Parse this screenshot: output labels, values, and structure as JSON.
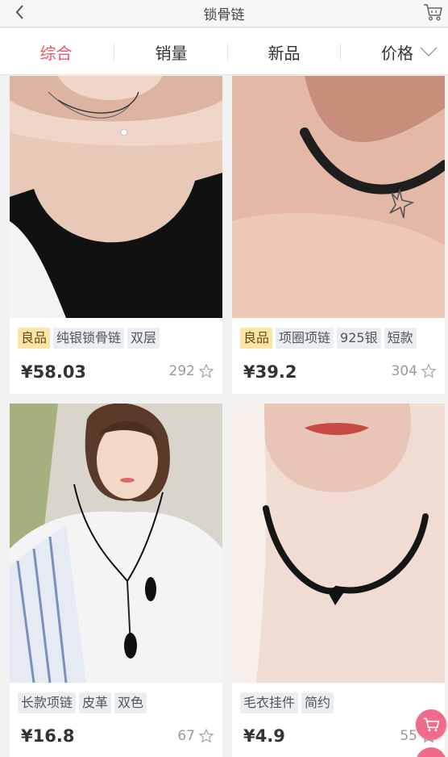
{
  "header": {
    "title": "锁骨链",
    "back_icon": "chevron-left-icon",
    "cart_icon": "shopping-cart-icon"
  },
  "sort_tabs": [
    {
      "label": "综合",
      "active": true
    },
    {
      "label": "销量",
      "active": false
    },
    {
      "label": "新品",
      "active": false
    },
    {
      "label": "价格",
      "active": false,
      "icon": "chevron-down-icon"
    }
  ],
  "products": [
    {
      "tags": [
        "良品",
        "纯银锁骨链",
        "双层"
      ],
      "price": "¥58.03",
      "favorites": "292"
    },
    {
      "tags": [
        "良品",
        "项圈项链",
        "925银",
        "短款"
      ],
      "price": "¥39.2",
      "favorites": "304"
    },
    {
      "tags": [
        "长款项链",
        "皮革",
        "双色"
      ],
      "price": "¥16.8",
      "favorites": "67"
    },
    {
      "tags": [
        "毛衣挂件",
        "简约"
      ],
      "price": "¥4.9",
      "favorites": "55"
    }
  ],
  "colors": {
    "accent": "#e8566f",
    "quality_tag_bg": "#fbe4a7",
    "tag_bg": "#eaedf2",
    "float_button": "#f06a8a"
  }
}
